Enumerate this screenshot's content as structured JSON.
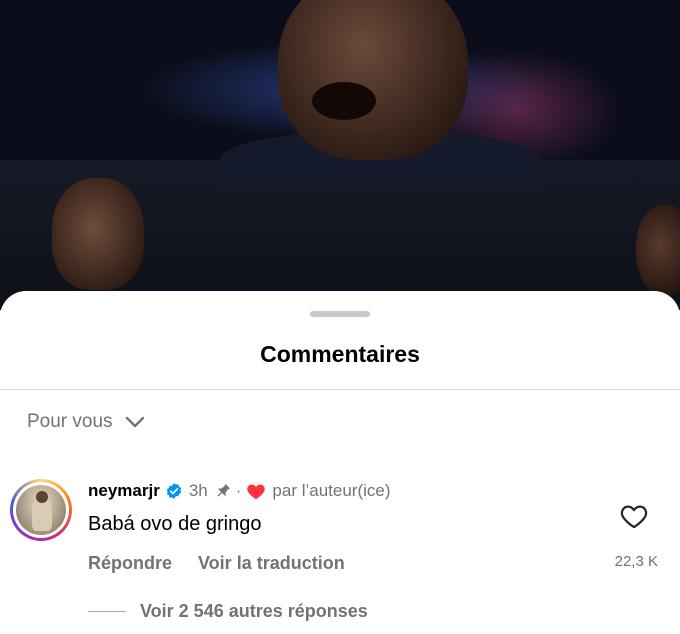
{
  "sheet": {
    "title": "Commentaires",
    "filter_label": "Pour vous"
  },
  "comment": {
    "username": "neymarjr",
    "verified": true,
    "time": "3h",
    "pinned": true,
    "separator": "·",
    "liked_by_author_label": "par l’auteur(ice)",
    "text": "Babá ovo de gringo",
    "reply_label": "Répondre",
    "translate_label": "Voir la traduction",
    "like_count": "22,3 K",
    "view_replies_label": "Voir 2 546 autres réponses"
  },
  "icons": {
    "verified": "verified-badge-icon",
    "pin": "pin-icon",
    "author_heart": "heart-filled-icon",
    "like": "heart-outline-icon",
    "filter_chevron": "chevron-down-icon"
  },
  "colors": {
    "verified_blue": "#0095f6",
    "heart_red": "#ff3040",
    "secondary_text": "#737373"
  }
}
